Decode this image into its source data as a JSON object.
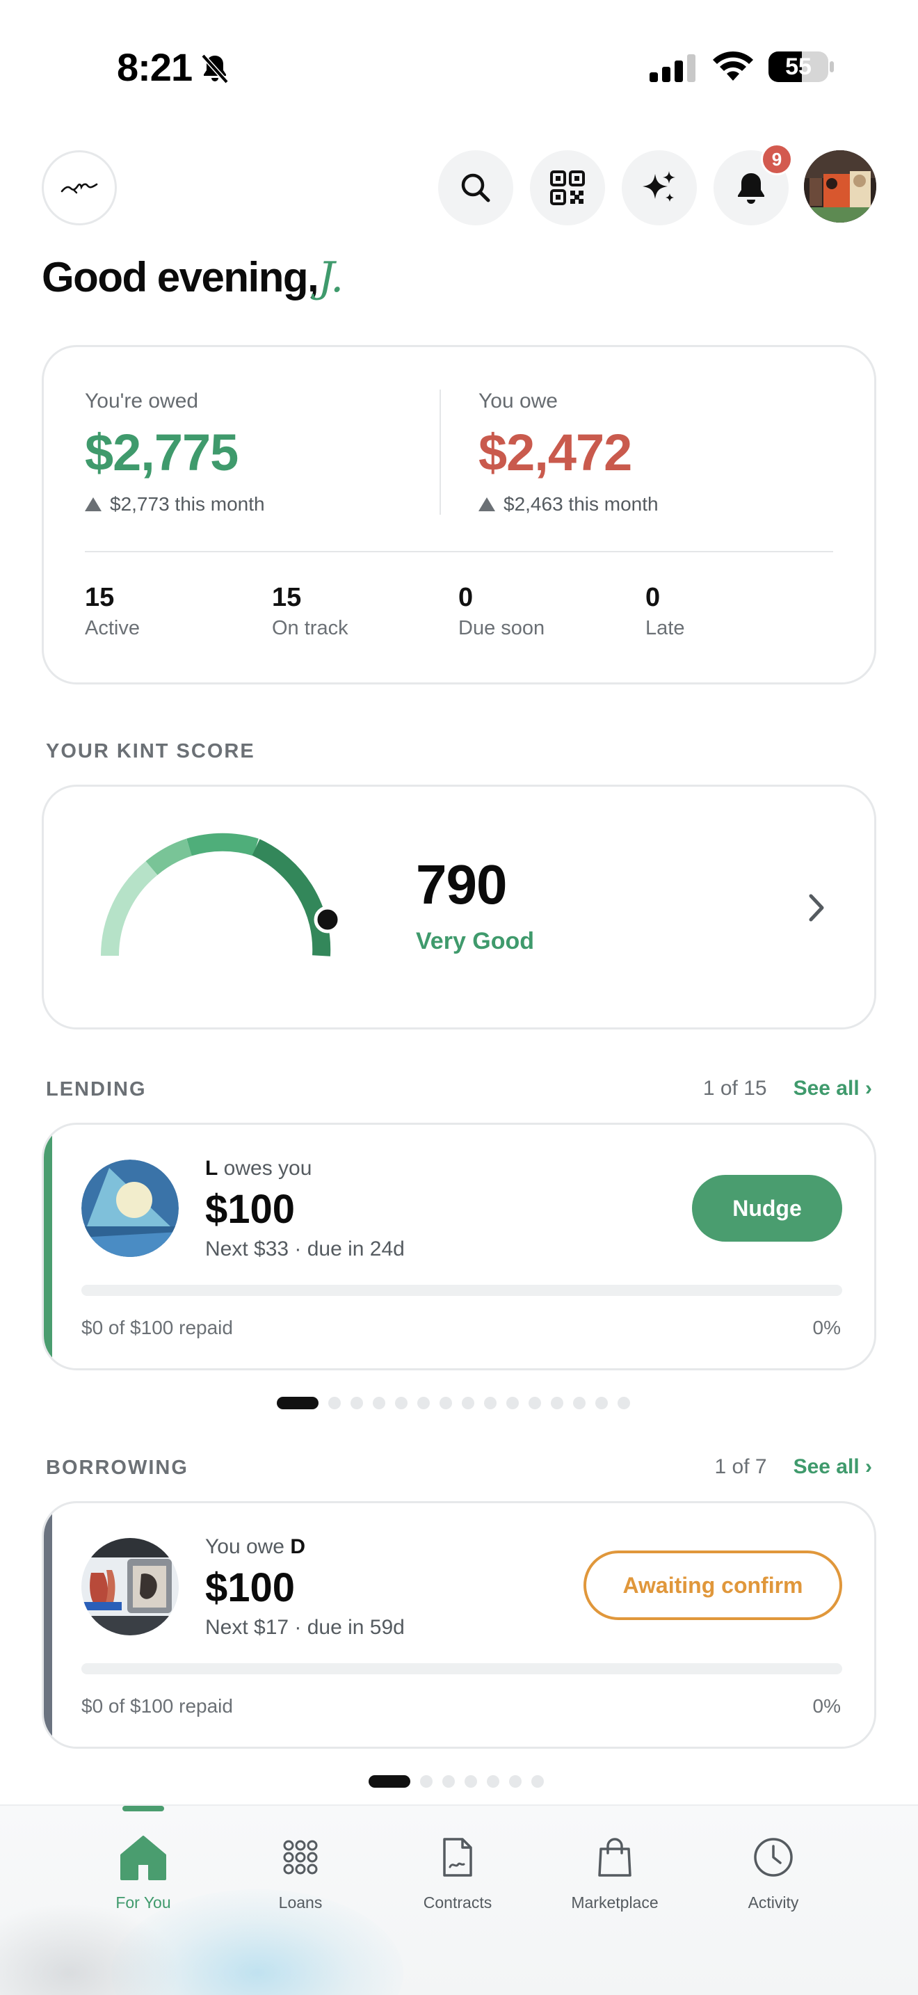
{
  "status_bar": {
    "time": "8:21",
    "battery": "55"
  },
  "header": {
    "notification_count": "9"
  },
  "greeting": {
    "text": "Good evening,",
    "name": "J."
  },
  "summary": {
    "owed": {
      "label": "You're owed",
      "value": "$2,775",
      "sub": "$2,773 this month",
      "color": "#3f9a6c"
    },
    "owe": {
      "label": "You owe",
      "value": "$2,472",
      "sub": "$2,463 this month",
      "color": "#c95a4d"
    },
    "stats": [
      {
        "value": "15",
        "label": "Active"
      },
      {
        "value": "15",
        "label": "On track"
      },
      {
        "value": "0",
        "label": "Due soon"
      },
      {
        "value": "0",
        "label": "Late"
      }
    ]
  },
  "kint_score": {
    "section_title": "YOUR KINT SCORE",
    "score": "790",
    "rating": "Very Good"
  },
  "lending": {
    "section_title": "LENDING",
    "count": "1 of 15",
    "see_all": "See all ›",
    "card": {
      "who_name": "L",
      "who_text": " owes you",
      "amount": "$100",
      "next": "Next $33 · due in 24d",
      "repaid": "$0 of $100 repaid",
      "percent": "0%",
      "progress": 0,
      "action": "Nudge"
    },
    "total_pages": 15,
    "current_page": 1
  },
  "borrowing": {
    "section_title": "BORROWING",
    "count": "1 of 7",
    "see_all": "See all ›",
    "card": {
      "who_text": "You owe ",
      "who_name": "D",
      "amount": "$100",
      "next": "Next $17 · due in 59d",
      "repaid": "$0 of $100 repaid",
      "percent": "0%",
      "progress": 0,
      "action": "Awaiting confirm"
    },
    "total_pages": 7,
    "current_page": 1
  },
  "bottom_nav": {
    "items": [
      {
        "label": "For You",
        "icon": "home-icon"
      },
      {
        "label": "Loans",
        "icon": "grid-dots-icon"
      },
      {
        "label": "Contracts",
        "icon": "document-icon"
      },
      {
        "label": "Marketplace",
        "icon": "shopping-bag-icon"
      },
      {
        "label": "Activity",
        "icon": "clock-icon"
      }
    ],
    "active": "For You"
  }
}
